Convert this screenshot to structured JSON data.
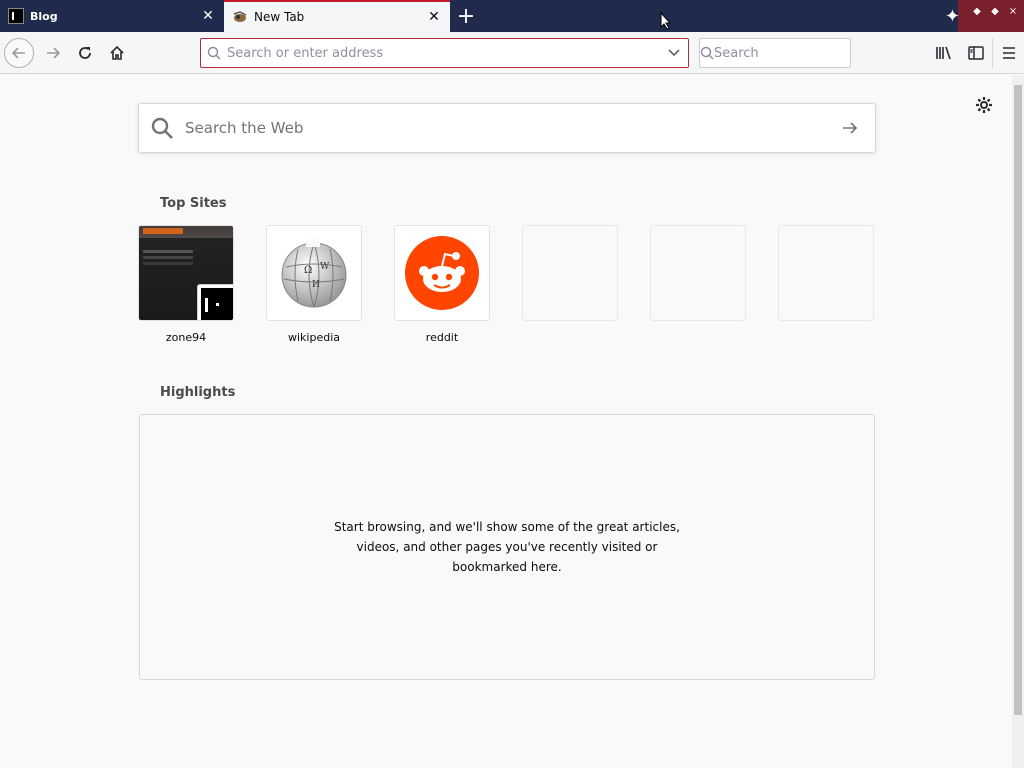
{
  "tabs": [
    {
      "title": "Blog",
      "active": false
    },
    {
      "title": "New Tab",
      "active": true
    }
  ],
  "navbar": {
    "url_placeholder": "Search or enter address",
    "search_placeholder": "Search"
  },
  "content": {
    "web_search_placeholder": "Search the Web",
    "top_sites_title": "Top Sites",
    "top_sites": [
      {
        "label": "zone94"
      },
      {
        "label": "wikipedia"
      },
      {
        "label": "reddit"
      },
      {
        "label": ""
      },
      {
        "label": ""
      },
      {
        "label": ""
      }
    ],
    "highlights_title": "Highlights",
    "highlights_empty": "Start browsing, and we'll show some of the great articles, videos, and other pages you've recently visited or bookmarked here."
  },
  "colors": {
    "tabstrip": "#1f2a4c",
    "accent": "#c4182c",
    "reddit": "#ff4500"
  }
}
